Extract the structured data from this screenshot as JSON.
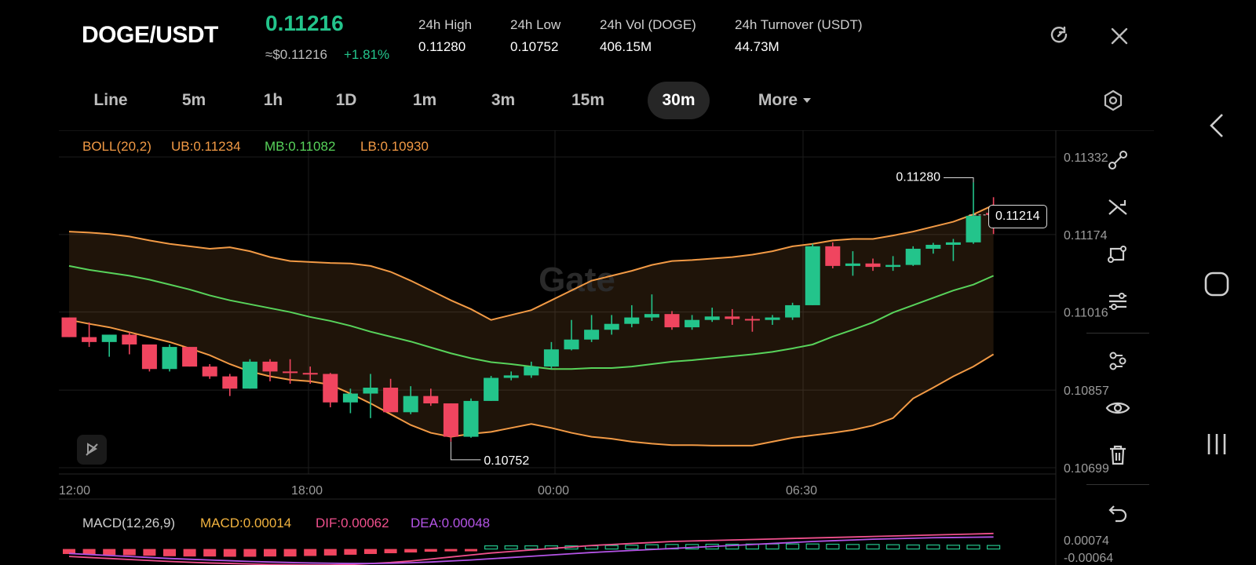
{
  "header": {
    "pair": "DOGE/USDT",
    "last_price": "0.11216",
    "usd_price": "≈$0.11216",
    "change": "+1.81%",
    "stats": [
      {
        "label": "24h   High",
        "value": "0.11280"
      },
      {
        "label": "24h   Low",
        "value": "0.10752"
      },
      {
        "label": "24h   Vol (DOGE)",
        "value": "406.15M"
      },
      {
        "label": "24h   Turnover (USDT)",
        "value": "44.73M"
      }
    ]
  },
  "intervals": [
    "Line",
    "5m",
    "1h",
    "1D",
    "1m",
    "3m",
    "15m",
    "30m",
    "More"
  ],
  "active_interval": "30m",
  "indicators": {
    "boll": {
      "name": "BOLL(20,2)",
      "ub": "UB:0.11234",
      "mb": "MB:0.11082",
      "lb": "LB:0.10930"
    },
    "macd": {
      "name": "MACD(12,26,9)",
      "macd": "MACD:0.00014",
      "dif": "DIF:0.00062",
      "dea": "DEA:0.00048"
    }
  },
  "watermark": "Gate",
  "current_price_tag": "0.11214",
  "colors": {
    "up": "#23c48b",
    "down": "#f0455f",
    "ub": "#f29a45",
    "mb": "#58d35b",
    "lb": "#f29a45",
    "dif": "#f0508d",
    "dea": "#b454e6",
    "active_bg": "#262626"
  },
  "chart_data": {
    "type": "candlestick",
    "price_axis": {
      "ticks": [
        "0.11332",
        "0.11174",
        "0.11016",
        "0.10857",
        "0.10699"
      ],
      "range": [
        0.10699,
        0.11332
      ]
    },
    "time_axis": {
      "ticks": [
        "12:00",
        "18:00",
        "00:00",
        "06:30"
      ]
    },
    "high_label": "0.11280",
    "low_label": "0.10752",
    "macd_axis": {
      "ticks": [
        "0.00074",
        "-0.00064"
      ]
    },
    "candles": [
      {
        "o": 0.11005,
        "h": 0.11005,
        "l": 0.10965,
        "c": 0.10965
      },
      {
        "o": 0.10965,
        "h": 0.10995,
        "l": 0.10945,
        "c": 0.10955
      },
      {
        "o": 0.10955,
        "h": 0.1097,
        "l": 0.10925,
        "c": 0.1097
      },
      {
        "o": 0.1097,
        "h": 0.10975,
        "l": 0.1093,
        "c": 0.1095
      },
      {
        "o": 0.1095,
        "h": 0.1095,
        "l": 0.10895,
        "c": 0.109
      },
      {
        "o": 0.109,
        "h": 0.1095,
        "l": 0.10895,
        "c": 0.10945
      },
      {
        "o": 0.10945,
        "h": 0.10945,
        "l": 0.10905,
        "c": 0.10905
      },
      {
        "o": 0.10905,
        "h": 0.1091,
        "l": 0.1088,
        "c": 0.10885
      },
      {
        "o": 0.10885,
        "h": 0.1089,
        "l": 0.10845,
        "c": 0.1086
      },
      {
        "o": 0.1086,
        "h": 0.1092,
        "l": 0.1086,
        "c": 0.10915
      },
      {
        "o": 0.10915,
        "h": 0.1092,
        "l": 0.10875,
        "c": 0.10895
      },
      {
        "o": 0.10895,
        "h": 0.1092,
        "l": 0.1087,
        "c": 0.10892
      },
      {
        "o": 0.10892,
        "h": 0.10905,
        "l": 0.1087,
        "c": 0.1089
      },
      {
        "o": 0.1089,
        "h": 0.10892,
        "l": 0.10822,
        "c": 0.10832
      },
      {
        "o": 0.10832,
        "h": 0.1086,
        "l": 0.1081,
        "c": 0.1085
      },
      {
        "o": 0.1085,
        "h": 0.1089,
        "l": 0.108,
        "c": 0.10862
      },
      {
        "o": 0.10862,
        "h": 0.1088,
        "l": 0.10812,
        "c": 0.10812
      },
      {
        "o": 0.10812,
        "h": 0.10865,
        "l": 0.10808,
        "c": 0.10845
      },
      {
        "o": 0.10845,
        "h": 0.1086,
        "l": 0.10825,
        "c": 0.1083
      },
      {
        "o": 0.1083,
        "h": 0.1083,
        "l": 0.10752,
        "c": 0.10762
      },
      {
        "o": 0.10762,
        "h": 0.1084,
        "l": 0.1076,
        "c": 0.10835
      },
      {
        "o": 0.10835,
        "h": 0.10886,
        "l": 0.10835,
        "c": 0.10882
      },
      {
        "o": 0.10882,
        "h": 0.10895,
        "l": 0.10877,
        "c": 0.10887
      },
      {
        "o": 0.10887,
        "h": 0.10915,
        "l": 0.10882,
        "c": 0.10905
      },
      {
        "o": 0.10905,
        "h": 0.10955,
        "l": 0.109,
        "c": 0.1094
      },
      {
        "o": 0.1094,
        "h": 0.11,
        "l": 0.10938,
        "c": 0.1096
      },
      {
        "o": 0.1096,
        "h": 0.1101,
        "l": 0.10955,
        "c": 0.1098
      },
      {
        "o": 0.1098,
        "h": 0.1101,
        "l": 0.1097,
        "c": 0.10992
      },
      {
        "o": 0.10992,
        "h": 0.1103,
        "l": 0.10985,
        "c": 0.11005
      },
      {
        "o": 0.11005,
        "h": 0.11052,
        "l": 0.10998,
        "c": 0.11012
      },
      {
        "o": 0.11012,
        "h": 0.11018,
        "l": 0.1098,
        "c": 0.10985
      },
      {
        "o": 0.10985,
        "h": 0.1101,
        "l": 0.1098,
        "c": 0.11
      },
      {
        "o": 0.11,
        "h": 0.11025,
        "l": 0.10996,
        "c": 0.11007
      },
      {
        "o": 0.11007,
        "h": 0.11022,
        "l": 0.1099,
        "c": 0.11002
      },
      {
        "o": 0.11002,
        "h": 0.11008,
        "l": 0.10976,
        "c": 0.11
      },
      {
        "o": 0.11,
        "h": 0.1101,
        "l": 0.1099,
        "c": 0.11005
      },
      {
        "o": 0.11005,
        "h": 0.11035,
        "l": 0.11,
        "c": 0.1103
      },
      {
        "o": 0.1103,
        "h": 0.11155,
        "l": 0.1103,
        "c": 0.1115
      },
      {
        "o": 0.1115,
        "h": 0.11158,
        "l": 0.11105,
        "c": 0.1111
      },
      {
        "o": 0.1111,
        "h": 0.1114,
        "l": 0.1109,
        "c": 0.11115
      },
      {
        "o": 0.11115,
        "h": 0.11125,
        "l": 0.111,
        "c": 0.11108
      },
      {
        "o": 0.11108,
        "h": 0.1113,
        "l": 0.111,
        "c": 0.11112
      },
      {
        "o": 0.11112,
        "h": 0.1115,
        "l": 0.1111,
        "c": 0.11145
      },
      {
        "o": 0.11145,
        "h": 0.11157,
        "l": 0.11135,
        "c": 0.11153
      },
      {
        "o": 0.11153,
        "h": 0.11165,
        "l": 0.1112,
        "c": 0.11158
      },
      {
        "o": 0.11158,
        "h": 0.1128,
        "l": 0.11155,
        "c": 0.11212
      },
      {
        "o": 0.11218,
        "h": 0.1125,
        "l": 0.11175,
        "c": 0.11214
      }
    ],
    "boll_ub": [
      0.1118,
      0.11178,
      0.11175,
      0.1117,
      0.11162,
      0.11155,
      0.1115,
      0.11145,
      0.11148,
      0.1114,
      0.11128,
      0.1112,
      0.11118,
      0.11116,
      0.11115,
      0.1111,
      0.11098,
      0.1108,
      0.1106,
      0.1104,
      0.11022,
      0.11,
      0.1101,
      0.1102,
      0.1104,
      0.1106,
      0.1108,
      0.1109,
      0.111,
      0.11112,
      0.1112,
      0.11122,
      0.11125,
      0.11128,
      0.11133,
      0.1114,
      0.1115,
      0.11155,
      0.11162,
      0.11165,
      0.11165,
      0.11172,
      0.1118,
      0.1119,
      0.112,
      0.11215,
      0.11234
    ],
    "boll_mb": [
      0.1111,
      0.11102,
      0.11096,
      0.1109,
      0.11082,
      0.11072,
      0.11062,
      0.1105,
      0.1104,
      0.11032,
      0.11024,
      0.11016,
      0.11006,
      0.10998,
      0.10988,
      0.10976,
      0.10966,
      0.10956,
      0.10944,
      0.10932,
      0.10922,
      0.10914,
      0.1091,
      0.10905,
      0.109,
      0.109,
      0.10902,
      0.10902,
      0.10905,
      0.1091,
      0.10915,
      0.10918,
      0.10922,
      0.10926,
      0.1093,
      0.10935,
      0.10942,
      0.1095,
      0.10966,
      0.1098,
      0.10995,
      0.11015,
      0.1103,
      0.11045,
      0.1106,
      0.11072,
      0.1109
    ],
    "boll_lb": [
      0.11,
      0.10992,
      0.10985,
      0.10975,
      0.10965,
      0.10955,
      0.10942,
      0.10928,
      0.1091,
      0.10895,
      0.10885,
      0.10878,
      0.10875,
      0.10868,
      0.1085,
      0.1083,
      0.10808,
      0.10786,
      0.1077,
      0.10762,
      0.10768,
      0.10772,
      0.1078,
      0.10788,
      0.1078,
      0.1077,
      0.10762,
      0.10758,
      0.10752,
      0.10748,
      0.10745,
      0.10745,
      0.10744,
      0.10744,
      0.10744,
      0.10752,
      0.1076,
      0.10765,
      0.1077,
      0.10776,
      0.10785,
      0.108,
      0.1084,
      0.10862,
      0.10885,
      0.10905,
      0.1093
    ],
    "macd_hist": [
      -0.0002,
      -0.00022,
      -0.00024,
      -0.00025,
      -0.00027,
      -0.00029,
      -0.0003,
      -0.0003,
      -0.00031,
      -0.00031,
      -0.0003,
      -0.0003,
      -0.00028,
      -0.00026,
      -0.00023,
      -0.0002,
      -0.00017,
      -0.00014,
      -0.00011,
      -8e-05,
      -5e-05,
      0.0,
      2e-05,
      5e-05,
      8e-05,
      0.0001,
      0.00012,
      0.00014,
      0.00015,
      0.00017,
      0.00018,
      0.00018,
      0.00019,
      0.00019,
      0.0002,
      0.0002,
      0.0002,
      0.0002,
      0.00019,
      0.00018,
      0.00018,
      0.00017,
      0.00016,
      0.00016,
      0.00015,
      0.00015,
      0.00014
    ],
    "macd_dif": [
      -0.0003,
      -0.00034,
      -0.00038,
      -0.00042,
      -0.00046,
      -0.0005,
      -0.00053,
      -0.00056,
      -0.00058,
      -0.0006,
      -0.00062,
      -0.00063,
      -0.00064,
      -0.00064,
      -0.00062,
      -0.00058,
      -0.00054,
      -0.00048,
      -0.0004,
      -0.00032,
      -0.00024,
      -0.00016,
      -0.0001,
      -4e-05,
      2e-05,
      8e-05,
      0.00014,
      0.00018,
      0.00022,
      0.00026,
      0.0003,
      0.00032,
      0.00034,
      0.00036,
      0.00038,
      0.0004,
      0.00042,
      0.00044,
      0.00046,
      0.00048,
      0.0005,
      0.00052,
      0.00054,
      0.00056,
      0.00058,
      0.0006,
      0.00062
    ],
    "macd_dea": [
      -0.00018,
      -0.00022,
      -0.00026,
      -0.0003,
      -0.00034,
      -0.00038,
      -0.00041,
      -0.00044,
      -0.00047,
      -0.0005,
      -0.00052,
      -0.00054,
      -0.00056,
      -0.00057,
      -0.00058,
      -0.00058,
      -0.00057,
      -0.00055,
      -0.00052,
      -0.00048,
      -0.00044,
      -0.00039,
      -0.00034,
      -0.00029,
      -0.00024,
      -0.00019,
      -0.00014,
      -0.0001,
      -6e-05,
      -2e-05,
      2e-05,
      6e-05,
      0.0001,
      0.00014,
      0.00018,
      0.00022,
      0.00026,
      0.0003,
      0.00033,
      0.00036,
      0.00039,
      0.00041,
      0.00043,
      0.00045,
      0.00046,
      0.00047,
      0.00048
    ]
  }
}
